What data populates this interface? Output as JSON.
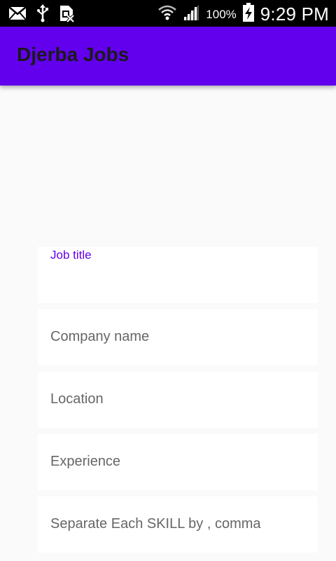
{
  "status_bar": {
    "icons_left": [
      "mail-icon",
      "usb-icon",
      "no-sim-icon"
    ],
    "icons_right": [
      "wifi-icon",
      "signal-icon",
      "battery-charging-icon"
    ],
    "battery_percent": "100%",
    "time": "9:29 PM"
  },
  "app_bar": {
    "title": "Djerba Jobs",
    "background": "#6200ee"
  },
  "form": {
    "job_title": {
      "label": "Job title",
      "value": "",
      "focused": true
    },
    "company_name": {
      "label": "Company name",
      "value": ""
    },
    "location": {
      "label": "Location",
      "value": ""
    },
    "experience": {
      "label": "Experience",
      "value": ""
    },
    "skills": {
      "label": "Separate Each SKILL by , comma",
      "value": ""
    }
  },
  "colors": {
    "accent": "#6200ee",
    "page_background": "#fafafa",
    "field_background": "#ffffff",
    "hint_text": "#666666"
  }
}
